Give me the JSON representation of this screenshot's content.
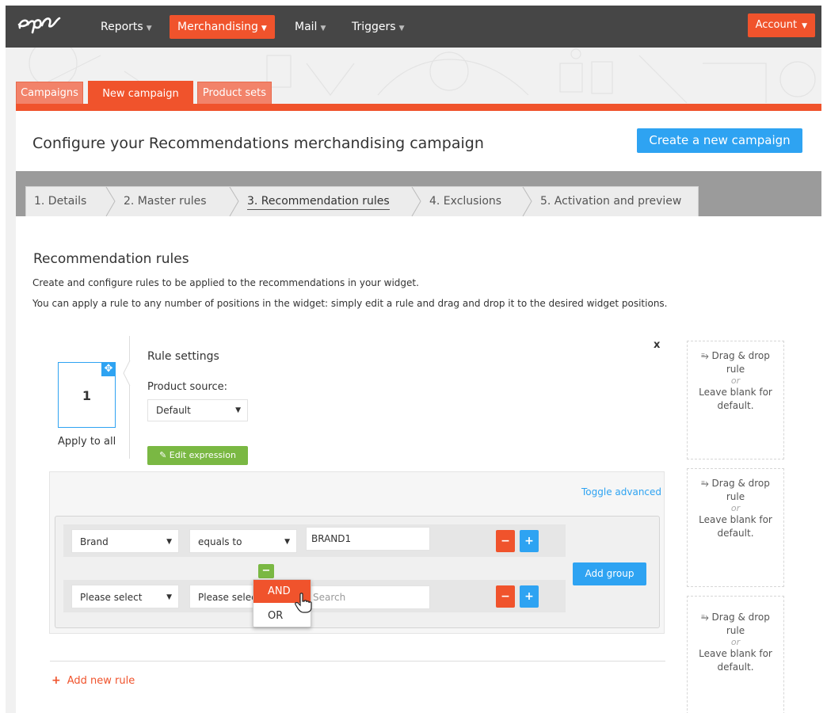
{
  "nav": {
    "logo": "epi",
    "reports": "Reports",
    "merchandising": "Merchandising",
    "mail": "Mail",
    "triggers": "Triggers",
    "account": "Account"
  },
  "tabs": [
    {
      "label": "Campaigns"
    },
    {
      "label": "New campaign"
    },
    {
      "label": "Product sets"
    }
  ],
  "header": {
    "title": "Configure your Recommendations merchandising campaign",
    "create_button": "Create a new campaign"
  },
  "steps": [
    {
      "label": "1. Details"
    },
    {
      "label": "2. Master rules"
    },
    {
      "label": "3. Recommendation rules"
    },
    {
      "label": "4. Exclusions"
    },
    {
      "label": "5. Activation and preview"
    }
  ],
  "section": {
    "title": "Recommendation rules",
    "desc1": "Create and configure rules to be applied to the recommendations in your widget.",
    "desc2": "You can apply a rule to any number of positions in the widget: simply edit a rule and drag and drop it to the desired widget positions."
  },
  "rule": {
    "number": "1",
    "apply_label": "Apply to all",
    "settings_title": "Rule settings",
    "close": "x",
    "product_source_label": "Product source:",
    "product_source_value": "Default",
    "edit_expression": "Edit expression"
  },
  "expression": {
    "toggle_advanced": "Toggle advanced",
    "row1": {
      "field": "Brand",
      "operator": "equals to",
      "value": "BRAND1"
    },
    "row2": {
      "field": "Please select",
      "operator": "Please select",
      "placeholder": "Search"
    },
    "add_group": "Add group",
    "logic_options": [
      "AND",
      "OR"
    ]
  },
  "add_new_rule": "Add new rule",
  "drop_zone": {
    "line1": "Drag & drop",
    "line2": "rule",
    "or": "or",
    "line3": "Leave blank for",
    "line4": "default."
  },
  "colors": {
    "brand_orange": "#f0532c",
    "accent_blue": "#2ea3f2",
    "action_green": "#7ab843",
    "navbar": "#464646"
  }
}
